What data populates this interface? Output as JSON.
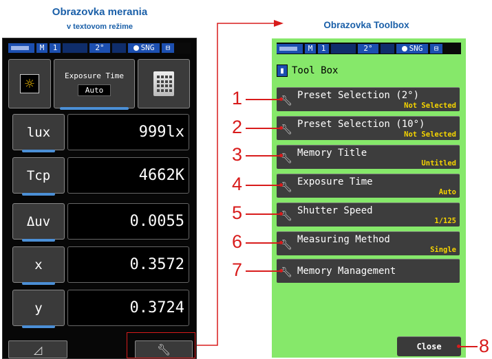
{
  "captions": {
    "left_title": "Obrazovka merania",
    "left_subtitle": "v textovom režime",
    "right_title": "Obrazovka Toolbox"
  },
  "statusbar": {
    "mode": "M",
    "memory": "1",
    "angle": "2°",
    "mode_label": "SNG"
  },
  "left_screen": {
    "exposure_title": "Exposure Time",
    "exposure_value": "Auto",
    "rows": [
      {
        "label": "lux",
        "value": "999lx"
      },
      {
        "label": "Tcp",
        "value": "4662K"
      },
      {
        "label": "Δuv",
        "value": "0.0055"
      },
      {
        "label": "x",
        "value": "0.3572"
      },
      {
        "label": "y",
        "value": "0.3724"
      }
    ],
    "bottom_left_icon": "delta-triangle-icon",
    "bottom_right_icon": "wrench-icon"
  },
  "right_screen": {
    "header_title": "Tool Box",
    "items": [
      {
        "label": "Preset Selection (2°)",
        "sub": "Not Selected"
      },
      {
        "label": "Preset Selection (10°)",
        "sub": "Not Selected"
      },
      {
        "label": "Memory Title",
        "sub": "Untitled"
      },
      {
        "label": "Exposure Time",
        "sub": "Auto"
      },
      {
        "label": "Shutter Speed",
        "sub": "1/125"
      },
      {
        "label": "Measuring Method",
        "sub": "Single"
      },
      {
        "label": "Memory Management",
        "sub": ""
      }
    ],
    "close_label": "Close"
  },
  "callouts": [
    "1",
    "2",
    "3",
    "4",
    "5",
    "6",
    "7",
    "8"
  ],
  "colors": {
    "caption_blue": "#1a5fa8",
    "toolbox_bg": "#86e86a",
    "callout_red": "#d81b1b",
    "sub_yellow": "#f5d400",
    "accent_blue": "#4b8fd6"
  }
}
